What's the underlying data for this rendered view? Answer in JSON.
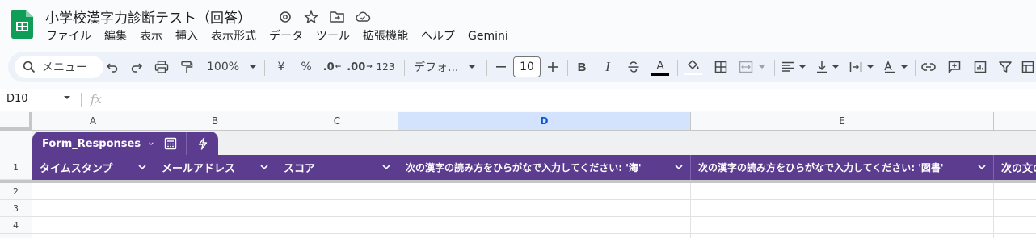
{
  "doc": {
    "title": "小学校漢字力診断テスト（回答）",
    "brand_color": "#0f9d58"
  },
  "menu": [
    "ファイル",
    "編集",
    "表示",
    "挿入",
    "表示形式",
    "データ",
    "ツール",
    "拡張機能",
    "ヘルプ",
    "Gemini"
  ],
  "toolbar": {
    "search_label": "メニュー",
    "zoom": "100%",
    "currency": "¥",
    "percent": "%",
    "dec_decrease": ".0",
    "dec_increase": ".00",
    "number_format": "123",
    "font": "デフォ...",
    "font_size": "10"
  },
  "formula_bar": {
    "cell_ref": "D10",
    "fx": "fx"
  },
  "columns": [
    "A",
    "B",
    "C",
    "D",
    "E"
  ],
  "selected_column": "D",
  "table": {
    "name": "Form_Responses",
    "color": "#5c3c8f",
    "headers": [
      "タイムスタンプ",
      "メールアドレス",
      "スコア",
      "次の漢字の読み方をひらがなで入力してください: '海'",
      "次の漢字の読み方をひらがなで入力してください: '図書'",
      "次の文の"
    ]
  },
  "rows": [
    "1",
    "2",
    "3",
    "4"
  ]
}
